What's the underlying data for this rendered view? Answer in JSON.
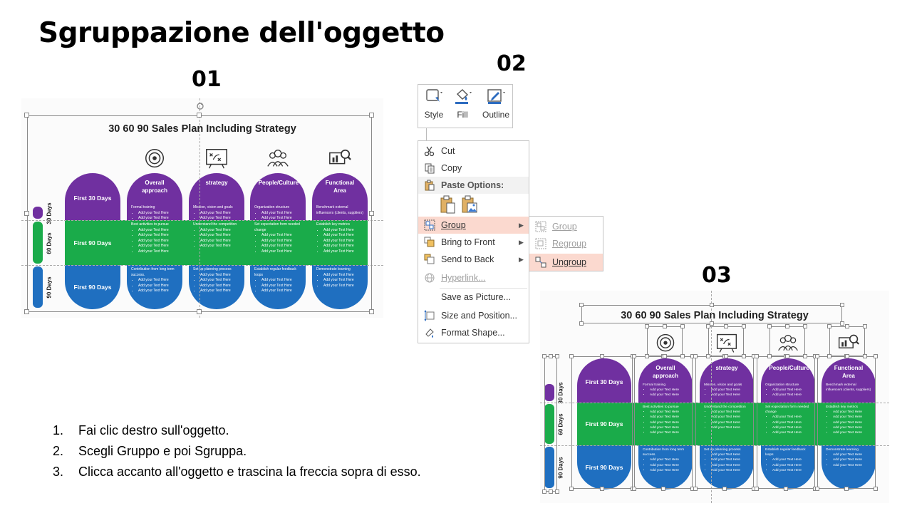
{
  "page": {
    "title": "Sgruppazione dell'oggetto",
    "step_numbers": [
      "01",
      "02",
      "03"
    ],
    "instructions": [
      {
        "n": "1.",
        "text": "Fai clic destro sull'oggetto."
      },
      {
        "n": "2.",
        "text": "Scegli Gruppo e poi Sgruppa."
      },
      {
        "n": "3.",
        "text": "Clicca accanto all'oggetto e trascina la freccia sopra di esso."
      }
    ]
  },
  "slide": {
    "title": "30 60 90 Sales Plan Including Strategy",
    "day_labels": [
      "30 Days",
      "60 Days",
      "90 Days"
    ],
    "first_labels": [
      "First 30 Days",
      "First 90 Days",
      "First 90 Days"
    ],
    "columns": [
      {
        "header": "Overall approach",
        "header_icon": "target-icon",
        "cells": [
          {
            "heading": "Formal training",
            "items": [
              "Add your Text Here",
              "Add your Text Here"
            ]
          },
          {
            "heading": "Best activities to pursue",
            "items": [
              "Add your Text Here",
              "Add your Text Here",
              "Add your Text Here",
              "Add your Text Here",
              "Add your Text Here"
            ]
          },
          {
            "heading": "Contribution from long term success.",
            "items": [
              "Add your Text Here",
              "Add your Text Here",
              "Add your Text Here"
            ]
          }
        ]
      },
      {
        "header": "strategy",
        "header_icon": "strategy-board-icon",
        "cells": [
          {
            "heading": "Mission, vision and goals",
            "items": [
              "Add your Text Here",
              "Add your Text Here"
            ]
          },
          {
            "heading": "Understand the competition",
            "items": [
              "Add your Text Here",
              "Add your Text Here",
              "Add your Text Here",
              "Add your Text Here"
            ]
          },
          {
            "heading": "Set up planning process",
            "items": [
              "Add your Text Here",
              "Add your Text Here",
              "Add your Text Here",
              "Add your Text Here"
            ]
          }
        ]
      },
      {
        "header": "People/Culture",
        "header_icon": "people-group-icon",
        "cells": [
          {
            "heading": "Organization structure",
            "items": [
              "Add your Text Here",
              "Add your Text Here"
            ]
          },
          {
            "heading": "Set expectation form needed change",
            "items": [
              "Add your Text Here",
              "Add your Text Here",
              "Add your Text Here",
              "Add your Text Here"
            ]
          },
          {
            "heading": "Establish regular feedback loops",
            "items": [
              "Add your Text Here",
              "Add your Text Here",
              "Add your Text Here"
            ]
          }
        ]
      },
      {
        "header": "Functional Area",
        "header_icon": "magnifier-chart-icon",
        "cells": [
          {
            "heading": "Benchmark external influencers (clients, suppliers)",
            "items": []
          },
          {
            "heading": "Establish key metrics",
            "items": [
              "Add your Text Here",
              "Add your Text Here",
              "Add your Text Here",
              "Add your Text Here",
              "Add your Text Here"
            ]
          },
          {
            "heading": "Demonstrate learning",
            "items": [
              "Add your Text Here",
              "Add your Text Here",
              "Add your Text Here"
            ]
          }
        ]
      }
    ],
    "colors": {
      "purple": "#7030a0",
      "green": "#1aab4a",
      "blue": "#1f6fc0"
    }
  },
  "ribbon": {
    "buttons": [
      {
        "label": "Style",
        "icon": "shape-style-icon"
      },
      {
        "label": "Fill",
        "icon": "paint-bucket-icon"
      },
      {
        "label": "Outline",
        "icon": "pen-outline-icon"
      }
    ]
  },
  "context_menu": {
    "cut": "Cut",
    "copy": "Copy",
    "paste_options": "Paste Options:",
    "group": "Group",
    "bring_to_front": "Bring to Front",
    "send_to_back": "Send to Back",
    "hyperlink": "Hyperlink...",
    "save_as_picture": "Save as Picture...",
    "size_and_position": "Size and Position...",
    "format_shape": "Format Shape...",
    "highlight_color": "#fbd9cf"
  },
  "submenu": {
    "group": "Group",
    "regroup": "Regroup",
    "ungroup": "Ungroup"
  }
}
